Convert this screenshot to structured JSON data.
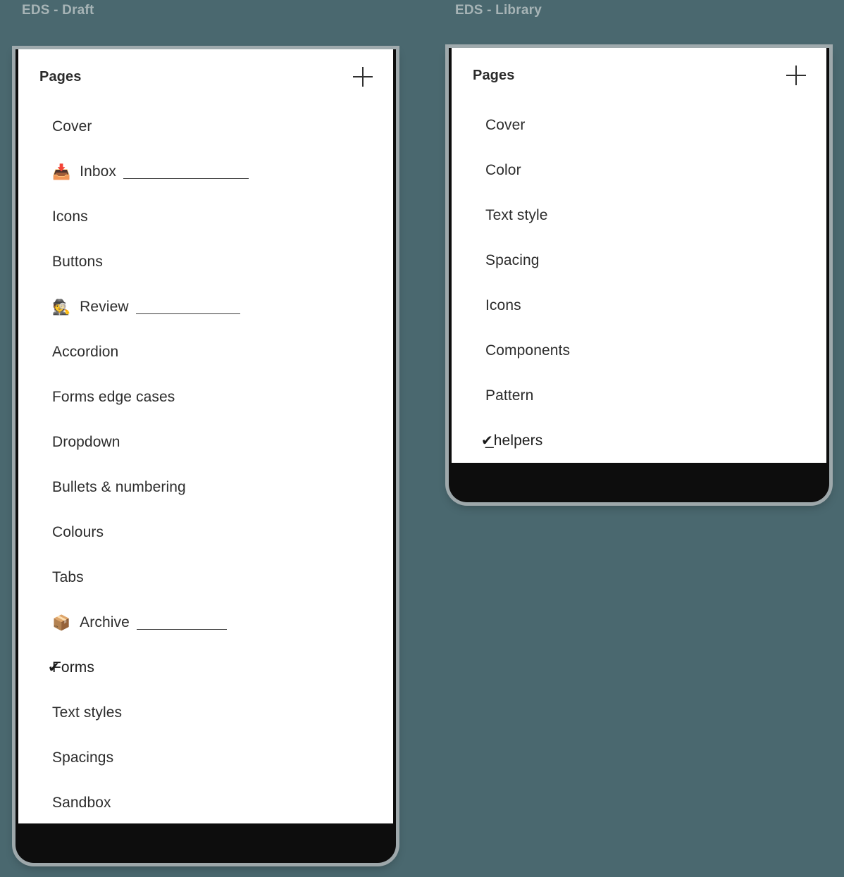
{
  "background_color": "#4a686f",
  "windows": [
    {
      "id": "draft",
      "title": "EDS - Draft",
      "panel": {
        "header_title": "Pages",
        "add_icon": "plus-icon",
        "items": [
          {
            "label": "Cover",
            "emoji": "",
            "rule_width": 0,
            "current": false
          },
          {
            "label": "Inbox",
            "emoji": "📥",
            "rule_width": 178,
            "current": false
          },
          {
            "label": "Icons",
            "emoji": "",
            "rule_width": 0,
            "current": false
          },
          {
            "label": "Buttons",
            "emoji": "",
            "rule_width": 0,
            "current": false
          },
          {
            "label": "Review",
            "emoji": "🕵",
            "rule_width": 148,
            "current": false
          },
          {
            "label": "Accordion",
            "emoji": "",
            "rule_width": 0,
            "current": false
          },
          {
            "label": "Forms edge cases",
            "emoji": "",
            "rule_width": 0,
            "current": false
          },
          {
            "label": "Dropdown",
            "emoji": "",
            "rule_width": 0,
            "current": false
          },
          {
            "label": "Bullets & numbering",
            "emoji": "",
            "rule_width": 0,
            "current": false
          },
          {
            "label": "Colours",
            "emoji": "",
            "rule_width": 0,
            "current": false
          },
          {
            "label": "Tabs",
            "emoji": "",
            "rule_width": 0,
            "current": false
          },
          {
            "label": "Archive",
            "emoji": "📦",
            "rule_width": 128,
            "current": false
          },
          {
            "label": "Forms",
            "emoji": "",
            "rule_width": 0,
            "current": true
          },
          {
            "label": "Text styles",
            "emoji": "",
            "rule_width": 0,
            "current": false
          },
          {
            "label": "Spacings",
            "emoji": "",
            "rule_width": 0,
            "current": false
          },
          {
            "label": "Sandbox",
            "emoji": "",
            "rule_width": 0,
            "current": false
          }
        ]
      }
    },
    {
      "id": "library",
      "title": "EDS - Library",
      "panel": {
        "header_title": "Pages",
        "add_icon": "plus-icon",
        "items": [
          {
            "label": "Cover",
            "emoji": "",
            "rule_width": 0,
            "current": false
          },
          {
            "label": "Color",
            "emoji": "",
            "rule_width": 0,
            "current": false
          },
          {
            "label": "Text style",
            "emoji": "",
            "rule_width": 0,
            "current": false
          },
          {
            "label": "Spacing",
            "emoji": "",
            "rule_width": 0,
            "current": false
          },
          {
            "label": "Icons",
            "emoji": "",
            "rule_width": 0,
            "current": false
          },
          {
            "label": "Components",
            "emoji": "",
            "rule_width": 0,
            "current": false
          },
          {
            "label": "Pattern",
            "emoji": "",
            "rule_width": 0,
            "current": false
          },
          {
            "label": "_helpers",
            "emoji": "",
            "rule_width": 0,
            "current": true
          }
        ]
      }
    }
  ],
  "check_glyph": "✔"
}
